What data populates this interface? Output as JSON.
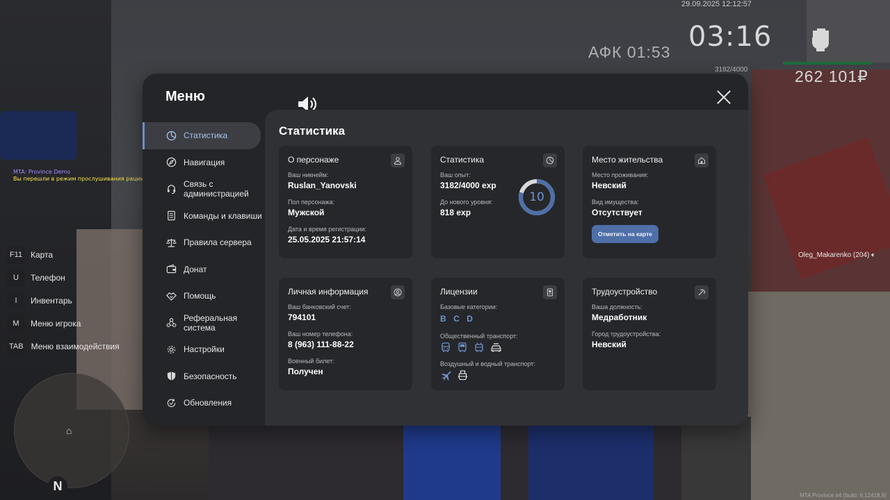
{
  "hud": {
    "date": "29.09.2025 12:12:57",
    "time": "03:16",
    "afk": "АФК 01:53",
    "exp": "3182/4000",
    "money": "262 101₽"
  },
  "chat": [
    {
      "text": "MTA: Province Demo"
    },
    {
      "text": "Вы перешли в режим прослушивания рации."
    }
  ],
  "hotkeys": [
    {
      "key": "F11",
      "label": "Карта"
    },
    {
      "key": "U",
      "label": "Телефон"
    },
    {
      "key": "I",
      "label": "Инвентарь"
    },
    {
      "key": "M",
      "label": "Меню игрока"
    },
    {
      "key": "TAB",
      "label": "Меню взаимодействия"
    }
  ],
  "player_tag": "Oleg_Makarenko (204)",
  "build": "MTA Province #4 (build: 6.12418.9)",
  "minimap": {
    "north": "N"
  },
  "menu": {
    "title": "Меню",
    "sidebar": [
      {
        "label": "Статистика",
        "icon": "pie-chart-icon",
        "active": true
      },
      {
        "label": "Навигация",
        "icon": "compass-icon"
      },
      {
        "label": "Связь с администрацией",
        "icon": "headset-icon"
      },
      {
        "label": "Команды и клавиши",
        "icon": "document-icon"
      },
      {
        "label": "Правила сервера",
        "icon": "scales-icon"
      },
      {
        "label": "Донат",
        "icon": "wallet-icon"
      },
      {
        "label": "Помощь",
        "icon": "handshake-icon"
      },
      {
        "label": "Реферальная система",
        "icon": "network-icon"
      },
      {
        "label": "Настройки",
        "icon": "gear-icon"
      },
      {
        "label": "Безопасность",
        "icon": "shield-icon"
      },
      {
        "label": "Обновления",
        "icon": "refresh-icon"
      }
    ],
    "content_title": "Статистика",
    "cards": {
      "character": {
        "title": "О персонаже",
        "nickname_label": "Ваш никнейм:",
        "nickname": "Ruslan_Yanovski",
        "gender_label": "Пол персонажа:",
        "gender": "Мужской",
        "reg_label": "Дата и время регистрации:",
        "reg": "25.05.2025 21:57:14"
      },
      "stats": {
        "title": "Статистика",
        "exp_label": "Ваш опыт:",
        "exp": "3182/4000 exp",
        "next_label": "До нового уровня:",
        "next": "818 exp",
        "level": "10",
        "progress": 0.7955
      },
      "residence": {
        "title": "Место жительства",
        "place_label": "Место проживания:",
        "place": "Невский",
        "property_label": "Вид имущества:",
        "property": "Отсутствует",
        "button": "Отметить на карте"
      },
      "personal": {
        "title": "Личная информация",
        "bank_label": "Ваш банковский счет:",
        "bank": "794101",
        "phone_label": "Ваш номер телефона:",
        "phone": "8 (963) 111-88-22",
        "military_label": "Военный билет:",
        "military": "Получен"
      },
      "licenses": {
        "title": "Лицензии",
        "base_label": "Базовые категории:",
        "base": [
          "B",
          "C",
          "D"
        ],
        "public_label": "Общественный транспорт:",
        "public_icons": [
          "bus-icon",
          "bus-front-icon",
          "trolleybus-icon",
          "taxi-icon"
        ],
        "air_label": "Воздушный и водный транспорт:",
        "air_icons": [
          "plane-icon",
          "ship-icon"
        ]
      },
      "employment": {
        "title": "Трудоустройство",
        "position_label": "Ваша должность:",
        "position": "Медработник",
        "city_label": "Город трудоустройства:",
        "city": "Невский"
      }
    }
  },
  "colors": {
    "accent": "#6f93cf",
    "button": "#4e6fa8",
    "panel": "#242528",
    "content": "#303135",
    "card": "#26272a"
  }
}
